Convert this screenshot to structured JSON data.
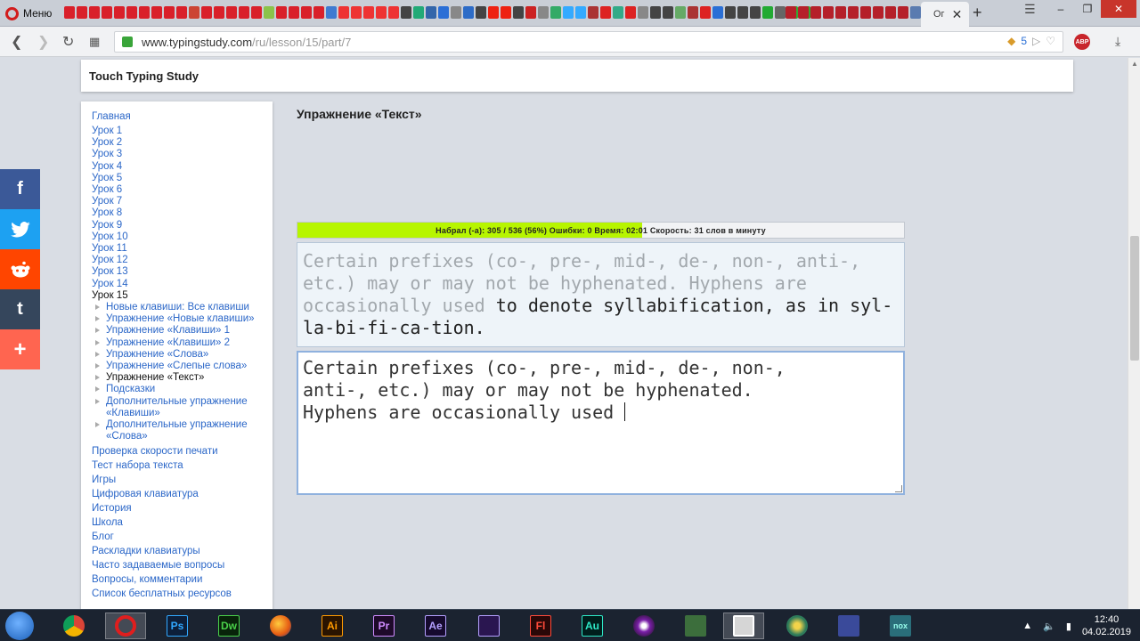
{
  "browser": {
    "menu_label": "Меню",
    "active_tab_label": "Ог",
    "url_host": "www.typingstudy.com",
    "url_path": "/ru/lesson/15/part/7",
    "badge_count": "5",
    "adblock_label": "ABP"
  },
  "site": {
    "title": "Touch Typing Study"
  },
  "sidebar": {
    "home": "Главная",
    "lessons": [
      "Урок 1",
      "Урок 2",
      "Урок 3",
      "Урок 4",
      "Урок 5",
      "Урок 6",
      "Урок 7",
      "Урок 8",
      "Урок 9",
      "Урок 10",
      "Урок 11",
      "Урок 12",
      "Урок 13",
      "Урок 14"
    ],
    "current_lesson": "Урок 15",
    "sub": [
      "Новые клавиши: Все клавиши",
      "Упражнение «Новые клавиши»",
      "Упражнение «Клавиши» 1",
      "Упражнение «Клавиши» 2",
      "Упражнение «Слова»",
      "Упражнение «Слепые слова»",
      "Упражнение «Текст»",
      "Подсказки",
      "Дополнительные упражнение «Клавиши»",
      "Дополнительные упражнение «Слова»"
    ],
    "links": [
      "Проверка скорости печати",
      "Тест набора текста",
      "Игры",
      "Цифровая клавиатура",
      "История",
      "Школа",
      "Блог",
      "Раскладки клавиатуры",
      "Часто задаваемые вопросы",
      "Вопросы, комментарии",
      "Список бесплатных ресурсов"
    ]
  },
  "exercise": {
    "title": "Упражнение «Текст»",
    "progress_text": "Набрал (-а): 305 / 536 (56%) Ошибки: 0 Время: 02:01 Скорость: 31 слов в минуту",
    "progress_fraction": 0.569,
    "sample_typed": "Certain prefixes (co-, pre-, mid-, de-, non-, anti-, etc.) may or may not be hyphenated. Hyphens are occasionally used",
    "sample_remaining": " to denote syllabification, as in syl-la-bi-fi-ca-tion.",
    "input_value": "Certain prefixes (co-, pre-, mid-, de-, non-,\nanti-, etc.) may or may not be hyphenated.\nHyphens are occasionally used "
  },
  "share": {
    "facebook": "f",
    "twitter": "t",
    "tumblr": "t",
    "more": "+"
  },
  "taskbar": {
    "apps": [
      "Ps",
      "Dw",
      "Ai",
      "Pr",
      "Ae",
      "Fl",
      "Au"
    ],
    "time": "12:40",
    "date": "04.02.2019"
  },
  "colors": {
    "progress_fill": "#b7f500",
    "link": "#2b67c8",
    "facebook": "#3b5998",
    "twitter": "#1da1f2",
    "reddit": "#ff4500",
    "tumblr": "#35465c",
    "more": "#ff6550"
  }
}
